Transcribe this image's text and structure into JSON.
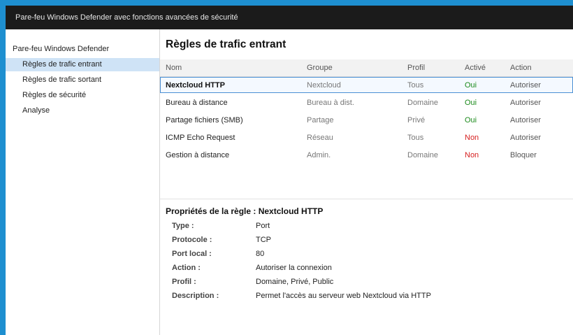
{
  "window": {
    "title": "Pare-feu Windows Defender avec fonctions avancées de sécurité"
  },
  "nav": {
    "root": "Pare-feu Windows Defender",
    "items": [
      {
        "label": "Règles de trafic entrant",
        "selected": true
      },
      {
        "label": "Règles de trafic sortant",
        "selected": false
      },
      {
        "label": "Règles de sécurité",
        "selected": false
      },
      {
        "label": "Analyse",
        "selected": false
      }
    ]
  },
  "main": {
    "heading": "Règles de trafic entrant",
    "columns": [
      "Nom",
      "Groupe",
      "Profil",
      "Activé",
      "Action"
    ],
    "rows": [
      {
        "name": "Nextcloud HTTP",
        "group": "Nextcloud",
        "profile": "Tous",
        "enabled": "Oui",
        "action": "Autoriser",
        "selected": true
      },
      {
        "name": "Bureau à distance",
        "group": "Bureau à dist.",
        "profile": "Domaine",
        "enabled": "Oui",
        "action": "Autoriser",
        "selected": false
      },
      {
        "name": "Partage fichiers (SMB)",
        "group": "Partage",
        "profile": "Privé",
        "enabled": "Oui",
        "action": "Autoriser",
        "selected": false
      },
      {
        "name": "ICMP Echo Request",
        "group": "Réseau",
        "profile": "Tous",
        "enabled": "Non",
        "action": "Autoriser",
        "selected": false
      },
      {
        "name": "Gestion à distance",
        "group": "Admin.",
        "profile": "Domaine",
        "enabled": "Non",
        "action": "Bloquer",
        "selected": false
      }
    ]
  },
  "properties": {
    "title": "Propriétés de la règle : Nextcloud HTTP",
    "fields": [
      {
        "label": "Type :",
        "value": "Port"
      },
      {
        "label": "Protocole :",
        "value": "TCP"
      },
      {
        "label": "Port local :",
        "value": "80"
      },
      {
        "label": "Action :",
        "value": "Autoriser la connexion"
      },
      {
        "label": "Profil :",
        "value": "Domaine, Privé, Public"
      },
      {
        "label": "Description :",
        "value": "Permet l'accès au serveur web Nextcloud via HTTP"
      }
    ]
  },
  "colors": {
    "enabled_yes": "#1a8a1a",
    "enabled_no": "#d62020",
    "selection": "#cfe3f6",
    "frame": "#1e8fd0"
  }
}
